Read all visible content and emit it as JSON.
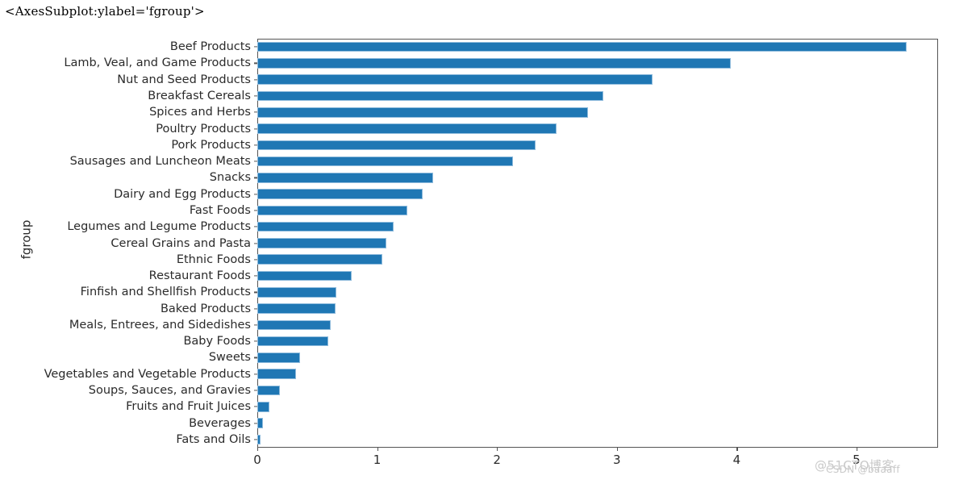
{
  "repr_title": "<AxesSubplot:ylabel='fgroup'>",
  "axes": {
    "ylabel": "fgroup",
    "xlabel": "",
    "xticks": [
      0,
      1,
      2,
      3,
      4,
      5
    ],
    "xtick_labels": [
      "0",
      "1",
      "2",
      "3",
      "4",
      "5"
    ],
    "bar_color": "#1f77b4",
    "bar_edge_color": "#8fbbdc",
    "spine_color": "#555555",
    "background": "#ffffff"
  },
  "watermark": {
    "line1": "@51CTO博客",
    "line2": "CSDN @baaaff"
  },
  "chart_data": {
    "type": "bar",
    "orientation": "horizontal",
    "title": "<AxesSubplot:ylabel='fgroup'>",
    "xlabel": "",
    "ylabel": "fgroup",
    "xlim": [
      0,
      5.68
    ],
    "grid": false,
    "legend": null,
    "categories": [
      "Beef Products",
      "Lamb, Veal, and Game Products",
      "Nut and Seed Products",
      "Breakfast Cereals",
      "Spices and Herbs",
      "Poultry Products",
      "Pork Products",
      "Sausages and Luncheon Meats",
      "Snacks",
      "Dairy and Egg Products",
      "Fast Foods",
      "Legumes and Legume Products",
      "Cereal Grains and Pasta",
      "Ethnic Foods",
      "Restaurant Foods",
      "Finfish and Shellfish Products",
      "Baked Products",
      "Meals, Entrees, and Sidedishes",
      "Baby Foods",
      "Sweets",
      "Vegetables and Vegetable Products",
      "Soups, Sauces, and Gravies",
      "Fruits and Fruit Juices",
      "Beverages",
      "Fats and Oils"
    ],
    "values": [
      5.42,
      3.95,
      3.3,
      2.89,
      2.76,
      2.5,
      2.32,
      2.13,
      1.47,
      1.38,
      1.25,
      1.14,
      1.08,
      1.04,
      0.79,
      0.66,
      0.65,
      0.61,
      0.59,
      0.36,
      0.32,
      0.19,
      0.1,
      0.045,
      0.025
    ]
  }
}
